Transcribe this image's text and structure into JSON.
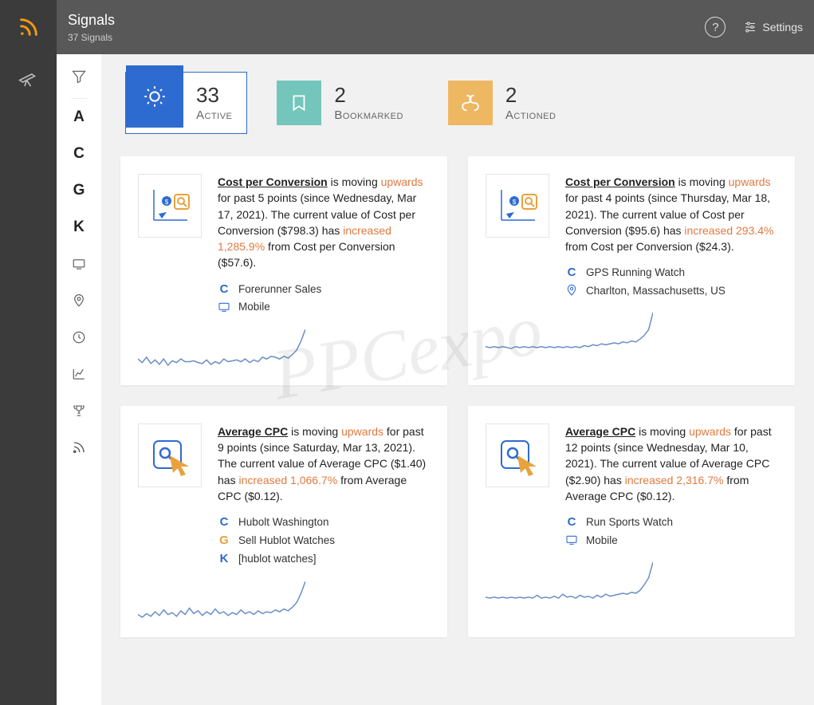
{
  "header": {
    "title": "Signals",
    "subtitle": "37 Signals",
    "settings_label": "Settings"
  },
  "side_letters": [
    "A",
    "C",
    "G",
    "K"
  ],
  "stats": {
    "active": {
      "count": "33",
      "label": "Active"
    },
    "bookmarked": {
      "count": "2",
      "label": "Bookmarked"
    },
    "actioned": {
      "count": "2",
      "label": "Actioned"
    }
  },
  "watermark": "PPCexpo",
  "cards": [
    {
      "metric": "Cost per Conversion",
      "direction": "upwards",
      "body_prefix": " is moving ",
      "body_mid": " for past 5 points (since Wednesday, Mar 17, 2021). The current value of Cost per Conversion ($798.3) has ",
      "increase": "increased 1,285.9%",
      "body_suffix": " from Cost per Conversion ($57.6).",
      "meta": [
        {
          "type": "C",
          "text": "Forerunner Sales"
        },
        {
          "type": "device",
          "text": "Mobile"
        }
      ]
    },
    {
      "metric": "Cost per Conversion",
      "direction": "upwards",
      "body_prefix": " is moving ",
      "body_mid": " for past 4 points (since Thursday, Mar 18, 2021). The current value of Cost per Conversion ($95.6) has ",
      "increase": "increased 293.4%",
      "body_suffix": " from Cost per Conversion ($24.3).",
      "meta": [
        {
          "type": "C",
          "text": "GPS Running Watch"
        },
        {
          "type": "location",
          "text": "Charlton, Massachusetts, US"
        }
      ]
    },
    {
      "metric": "Average CPC",
      "direction": "upwards",
      "body_prefix": " is moving ",
      "body_mid": " for past 9 points (since Saturday, Mar 13, 2021). The current value of Average CPC ($1.40) has ",
      "increase": "increased 1,066.7%",
      "body_suffix": " from Average CPC ($0.12).",
      "meta": [
        {
          "type": "C",
          "text": "Hubolt Washington"
        },
        {
          "type": "G",
          "text": "Sell Hublot Watches"
        },
        {
          "type": "K",
          "text": "[hublot watches]"
        }
      ]
    },
    {
      "metric": "Average CPC",
      "direction": "upwards",
      "body_prefix": " is moving ",
      "body_mid": " for past 12 points (since Wednesday, Mar 10, 2021). The current value of Average CPC ($2.90) has ",
      "increase": "increased 2,316.7%",
      "body_suffix": " from Average CPC ($0.12).",
      "meta": [
        {
          "type": "C",
          "text": "Run Sports Watch"
        },
        {
          "type": "device",
          "text": "Mobile"
        }
      ]
    }
  ],
  "chart_data": [
    {
      "card": 0,
      "type": "line",
      "values": [
        30,
        22,
        34,
        20,
        28,
        18,
        30,
        16,
        26,
        22,
        30,
        24,
        24,
        26,
        22,
        20,
        28,
        18,
        24,
        20,
        30,
        24,
        26,
        28,
        24,
        30,
        22,
        28,
        24,
        34,
        30,
        36,
        34,
        30,
        36,
        32,
        40,
        50,
        70,
        96
      ]
    },
    {
      "card": 1,
      "type": "line",
      "values": [
        22,
        20,
        22,
        20,
        22,
        20,
        18,
        22,
        20,
        22,
        20,
        22,
        20,
        22,
        20,
        22,
        20,
        22,
        20,
        22,
        20,
        22,
        20,
        24,
        22,
        26,
        24,
        28,
        26,
        28,
        30,
        28,
        32,
        30,
        34,
        32,
        38,
        46,
        58,
        94
      ]
    },
    {
      "card": 2,
      "type": "line",
      "values": [
        24,
        18,
        26,
        20,
        30,
        22,
        34,
        24,
        28,
        20,
        32,
        24,
        38,
        26,
        32,
        22,
        30,
        24,
        36,
        26,
        30,
        22,
        28,
        24,
        34,
        26,
        30,
        24,
        32,
        26,
        30,
        28,
        34,
        30,
        36,
        32,
        40,
        50,
        70,
        96
      ]
    },
    {
      "card": 3,
      "type": "line",
      "values": [
        22,
        20,
        22,
        20,
        22,
        20,
        22,
        20,
        22,
        20,
        22,
        20,
        26,
        20,
        22,
        20,
        24,
        20,
        28,
        22,
        24,
        20,
        26,
        22,
        24,
        20,
        26,
        22,
        28,
        24,
        26,
        28,
        30,
        28,
        32,
        30,
        36,
        48,
        62,
        94
      ]
    }
  ]
}
